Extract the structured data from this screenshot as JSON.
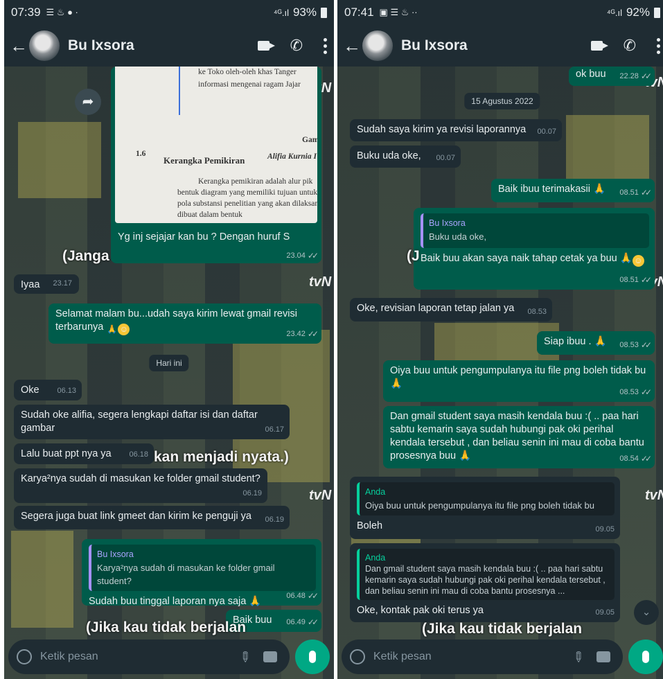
{
  "screens": [
    {
      "status": {
        "time": "07:39",
        "icons_left": "☰ ♨ ● ·",
        "signal": "⁴ᴳ.ıl",
        "battery": "93%"
      },
      "header": {
        "contact": "Bu Ixsora"
      },
      "image_message": {
        "lines": [
          "ke Toko oleh-oleh khas Tanger",
          "informasi mengenai ragam Jajar",
          "Gam",
          "Alifia Kurnia I",
          "1.6",
          "Kerangka Pemikiran",
          "Kerangka pemikiran adalah alur pik",
          "bentuk diagram yang memiliki tujuan untuk",
          "pola substansi penelitian yang akan dilaksana",
          "dibuat dalam bentuk"
        ],
        "caption": "Yg inj sejajar kan bu ? Dengan huruf S",
        "time": "23.04"
      },
      "overlay": {
        "top": "(Janga",
        "mid": "kan menjadi nyata.)",
        "bottom": "(Jika kau tidak berjalan"
      },
      "messages": [
        {
          "text": "Iyaa",
          "time": "23.17"
        },
        {
          "text": "Selamat malam bu...udah saya kirim lewat gmail revisi terbarunya",
          "time": "23.42"
        },
        {
          "date": "Hari ini"
        },
        {
          "text": "Oke",
          "time": "06.13"
        },
        {
          "text": "Sudah oke alifia, segera lengkapi daftar isi dan daftar gambar",
          "time": "06.17"
        },
        {
          "text": "Lalu buat ppt nya ya",
          "time": "06.18"
        },
        {
          "text": "Karya²nya sudah di masukan ke folder gmail student?",
          "time": "06.19"
        },
        {
          "text": "Segera juga buat link gmeet dan kirim ke penguji ya",
          "time": "06.19"
        },
        {
          "quote_name": "Bu Ixsora",
          "quote_text": "Karya²nya sudah di masukan ke folder gmail student?",
          "text": "Sudah buu tinggal laporan nya saja",
          "time": "06.48"
        },
        {
          "text": "Baik buu",
          "time": "06.49"
        }
      ],
      "input": {
        "placeholder": "Ketik pesan"
      }
    },
    {
      "status": {
        "time": "07:41",
        "icons_left": "▣ ☰ ♨ ··",
        "signal": "⁴ᴳ.ıl",
        "battery": "92%"
      },
      "header": {
        "contact": "Bu Ixsora"
      },
      "overlay": {
        "top": "(J",
        "bottom": "(Jika kau tidak berjalan"
      },
      "messages": [
        {
          "text": "ok buu",
          "time": "22.28"
        },
        {
          "date": "15 Agustus 2022"
        },
        {
          "text": "Sudah saya kirim ya revisi laporannya",
          "time": "00.07"
        },
        {
          "text": "Buku uda oke,",
          "time": "00.07"
        },
        {
          "text": "Baik ibuu terimakasii",
          "time": "08.51"
        },
        {
          "quote_name": "Bu Ixsora",
          "quote_text": "Buku uda oke,",
          "text": "Baik buu akan saya naik tahap cetak ya buu",
          "time": "08.51"
        },
        {
          "text": "Oke, revisian laporan tetap jalan ya",
          "time": "08.53"
        },
        {
          "text": "Siap ibuu .",
          "time": "08.53"
        },
        {
          "text": "Oiya buu untuk pengumpulanya itu file png boleh tidak bu",
          "time": "08.53"
        },
        {
          "text": "Dan gmail student saya masih kendala buu :( .. paa hari sabtu kemarin saya sudah hubungi pak oki perihal kendala tersebut , dan beliau senin ini mau di coba bantu prosesnya buu",
          "time": "08.54"
        },
        {
          "quote_name": "Anda",
          "quote_text": "Oiya buu untuk pengumpulanya itu file png boleh tidak bu",
          "text": "Boleh",
          "time": "09.05"
        },
        {
          "quote_name": "Anda",
          "quote_text": "Dan gmail student saya masih kendala buu :( .. paa hari sabtu kemarin saya sudah hubungi pak oki perihal kendala tersebut , dan beliau senin ini mau di coba bantu prosesnya ...",
          "text": "Oke, kontak pak oki terus ya",
          "time": "09.05"
        }
      ],
      "input": {
        "placeholder": "Ketik pesan"
      }
    }
  ],
  "watermark": "tvN",
  "colors": {
    "incoming": "#1f2c33",
    "outgoing": "#005c4b",
    "accent": "#00a884",
    "header": "#1f2c33"
  }
}
